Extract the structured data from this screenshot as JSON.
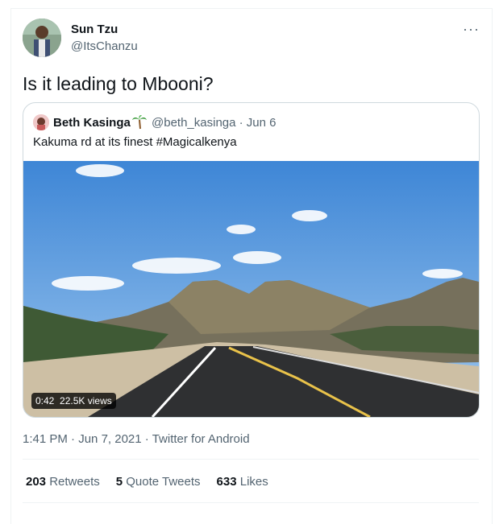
{
  "author": {
    "name": "Sun Tzu",
    "handle": "@ItsChanzu"
  },
  "tweet": {
    "text": "Is it leading to Mbooni?"
  },
  "more_label": "···",
  "quoted": {
    "name": "Beth Kasinga",
    "handle_date": "@beth_kasinga · Jun 6",
    "text": "Kakuma rd at its finest #Magicalkenya",
    "video_duration": "0:42",
    "video_views": "22.5K views"
  },
  "meta": {
    "time": "1:41 PM",
    "date": "Jun 7, 2021",
    "source": "Twitter for Android"
  },
  "stats": {
    "retweets_count": "203",
    "retweets_label": "Retweets",
    "quotes_count": "5",
    "quotes_label": "Quote Tweets",
    "likes_count": "633",
    "likes_label": "Likes"
  }
}
